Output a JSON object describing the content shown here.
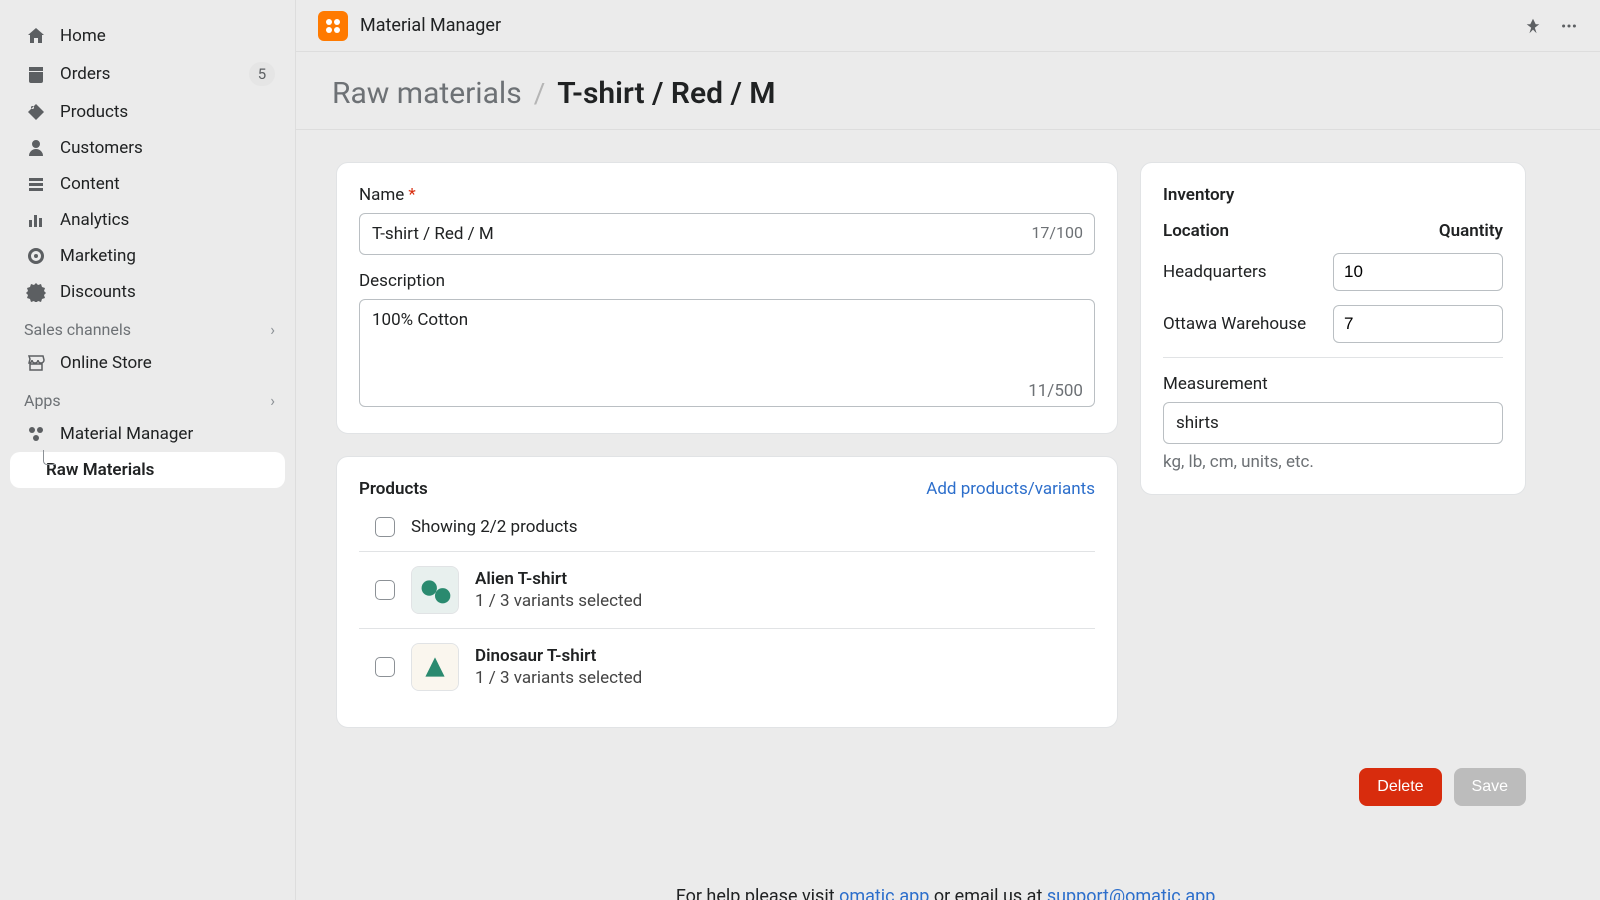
{
  "sidebar": {
    "items": [
      {
        "label": "Home",
        "icon": "home"
      },
      {
        "label": "Orders",
        "icon": "orders",
        "badge": "5"
      },
      {
        "label": "Products",
        "icon": "products"
      },
      {
        "label": "Customers",
        "icon": "customers"
      },
      {
        "label": "Content",
        "icon": "content"
      },
      {
        "label": "Analytics",
        "icon": "analytics"
      },
      {
        "label": "Marketing",
        "icon": "marketing"
      },
      {
        "label": "Discounts",
        "icon": "discounts"
      }
    ],
    "sales_channels_label": "Sales channels",
    "sales_channels": [
      {
        "label": "Online Store"
      }
    ],
    "apps_label": "Apps",
    "apps": [
      {
        "label": "Material Manager"
      },
      {
        "label": "Raw Materials",
        "active": true
      }
    ]
  },
  "topbar": {
    "app_name": "Material Manager"
  },
  "breadcrumb": {
    "root": "Raw materials",
    "sep": "/",
    "current": "T-shirt / Red / M"
  },
  "form": {
    "name_label": "Name",
    "name_value": "T-shirt / Red / M",
    "name_counter": "17/100",
    "desc_label": "Description",
    "desc_value": "100% Cotton",
    "desc_counter": "11/500"
  },
  "products_card": {
    "title": "Products",
    "add_link": "Add products/variants",
    "showing": "Showing 2/2 products",
    "items": [
      {
        "name": "Alien T-shirt",
        "sub": "1 / 3 variants selected"
      },
      {
        "name": "Dinosaur T-shirt",
        "sub": "1 / 3 variants selected"
      }
    ]
  },
  "inventory_card": {
    "title": "Inventory",
    "loc_header": "Location",
    "qty_header": "Quantity",
    "rows": [
      {
        "loc": "Headquarters",
        "qty": "10"
      },
      {
        "loc": "Ottawa Warehouse",
        "qty": "7"
      }
    ],
    "measurement_label": "Measurement",
    "measurement_value": "shirts",
    "measurement_hint": "kg, lb, cm, units, etc."
  },
  "actions": {
    "delete": "Delete",
    "save": "Save"
  },
  "help": {
    "prefix": "For help please visit ",
    "link1": "omatic.app",
    "mid": " or email us at ",
    "link2": "support@omatic.app",
    "suffix": "."
  }
}
